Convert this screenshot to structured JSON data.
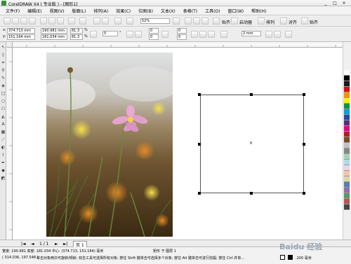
{
  "window": {
    "title": "CorelDRAW X4 ( 专业版 ) - [图形1]",
    "minimize": "_",
    "maximize": "□",
    "close": "×"
  },
  "menu": [
    "文件(F)",
    "编辑(E)",
    "视图(V)",
    "版面(L)",
    "排列(A)",
    "效果(C)",
    "位图(B)",
    "文本(X)",
    "表格(T)",
    "工具(O)",
    "窗口(W)",
    "帮助(H)"
  ],
  "toolbar1": {
    "zoom_value": "52%",
    "snap_label": "贴齐",
    "launcher_label": "启动器",
    "tab_a": "排列",
    "tab_b": "对齐",
    "menu_right": "贴齐"
  },
  "toolbar2": {
    "x": "374.713 mm",
    "y": "151.164 mm",
    "w": "190.981 mm",
    "h": "181.034 mm",
    "scale_w": "81.3",
    "scale_h": "81.3",
    "scale_unit": "%",
    "angle": "0",
    "angle_unit": "°",
    "corner1": "0",
    "corner2": "0",
    "corner3": "0",
    "corner4": "0",
    "outline": "2 mm"
  },
  "pagebar": {
    "page_count": "1 / 1",
    "page_tab": "页 1"
  },
  "status": {
    "line1": "宽度: 190.981  高度: 181.034  中心: (374.713, 151.164) 毫米",
    "line1_right": "矩形 于 图层 1",
    "line2": "( 314.036, 197.548 )",
    "line2_hint": "单击对象两次可旋转/倾斜; 双击工具可选择所有对象; 按住 Shift 键单击可选择多个对象; 按住 Alt 键单击可进行挖掘; 按住 Ctrl 并单...",
    "outline_label": ".200 毫米"
  },
  "watermark": "Baidu 经验",
  "colors": {
    "titlebar_bg": "#ececec",
    "palette": [
      "#ffffff",
      "#000000",
      "#1a1a1a",
      "#e30613",
      "#f39200",
      "#ffed00",
      "#009640",
      "#00a0e3",
      "#1d4f9c",
      "#662483",
      "#e6007e",
      "#be1622",
      "#7a4a1f",
      "#c1c1c1",
      "#878787",
      "#9fd5b5",
      "#b2dbe9",
      "#e8d4e8",
      "#f6c5a0",
      "#ddd6a0",
      "#5a7bb5",
      "#8e6fb0",
      "#5a9a60",
      "#c05050",
      "#444444"
    ]
  }
}
